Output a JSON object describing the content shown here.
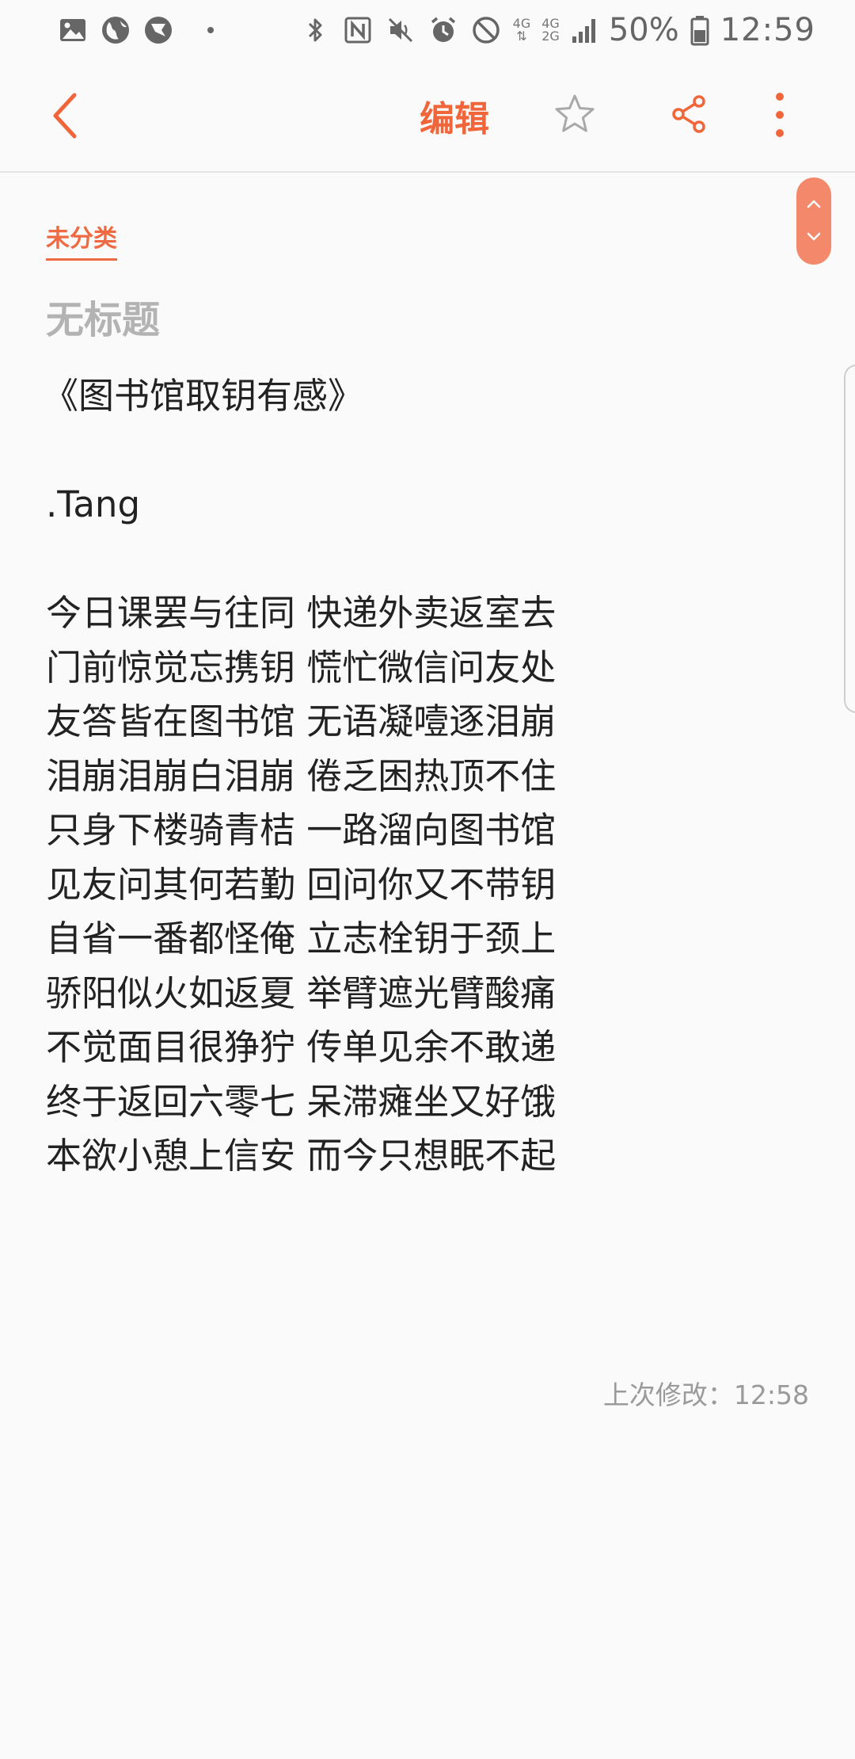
{
  "status_bar": {
    "network_top": "4G",
    "network_bottom": "2G",
    "network_single": "4G",
    "battery": "50%",
    "time": "12:59"
  },
  "toolbar": {
    "edit_label": "编辑",
    "accent_color": "#f0663a"
  },
  "note": {
    "category": "未分类",
    "title": "无标题",
    "heading": "《图书馆取钥有感》",
    "author": ".Tang",
    "lines": [
      "今日课罢与往同 快递外卖返室去",
      "门前惊觉忘携钥 慌忙微信问友处",
      "友答皆在图书馆 无语凝噎逐泪崩",
      "泪崩泪崩白泪崩 倦乏困热顶不住",
      "只身下楼骑青桔 一路溜向图书馆",
      "见友问其何若勤 回问你又不带钥",
      "自省一番都怪俺 立志栓钥于颈上",
      "骄阳似火如返夏 举臂遮光臂酸痛",
      "不觉面目很狰狞 传单见余不敢递",
      "终于返回六零七 呆滞瘫坐又好饿",
      "本欲小憩上信安 而今只想眠不起"
    ],
    "last_modified": "上次修改：12:58"
  }
}
